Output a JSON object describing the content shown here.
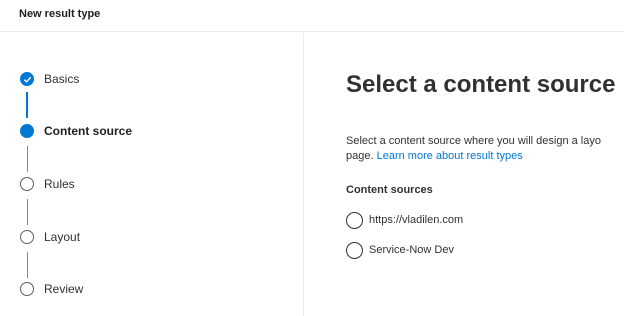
{
  "header": {
    "title": "New result type"
  },
  "wizard": {
    "steps": [
      {
        "label": "Basics",
        "state": "done"
      },
      {
        "label": "Content source",
        "state": "current"
      },
      {
        "label": "Rules",
        "state": "pending"
      },
      {
        "label": "Layout",
        "state": "pending"
      },
      {
        "label": "Review",
        "state": "pending"
      }
    ]
  },
  "main": {
    "title": "Select a content source",
    "description": "Select a content source where you will design a layo",
    "description_line2": "page. ",
    "learn_more": "Learn more about result types",
    "section_label": "Content sources",
    "options": [
      {
        "label": "https://vladilen.com",
        "selected": false
      },
      {
        "label": "Service-Now Dev",
        "selected": false
      }
    ]
  },
  "colors": {
    "accent": "#0078d4",
    "text": "#323130",
    "border": "#edebe9"
  }
}
